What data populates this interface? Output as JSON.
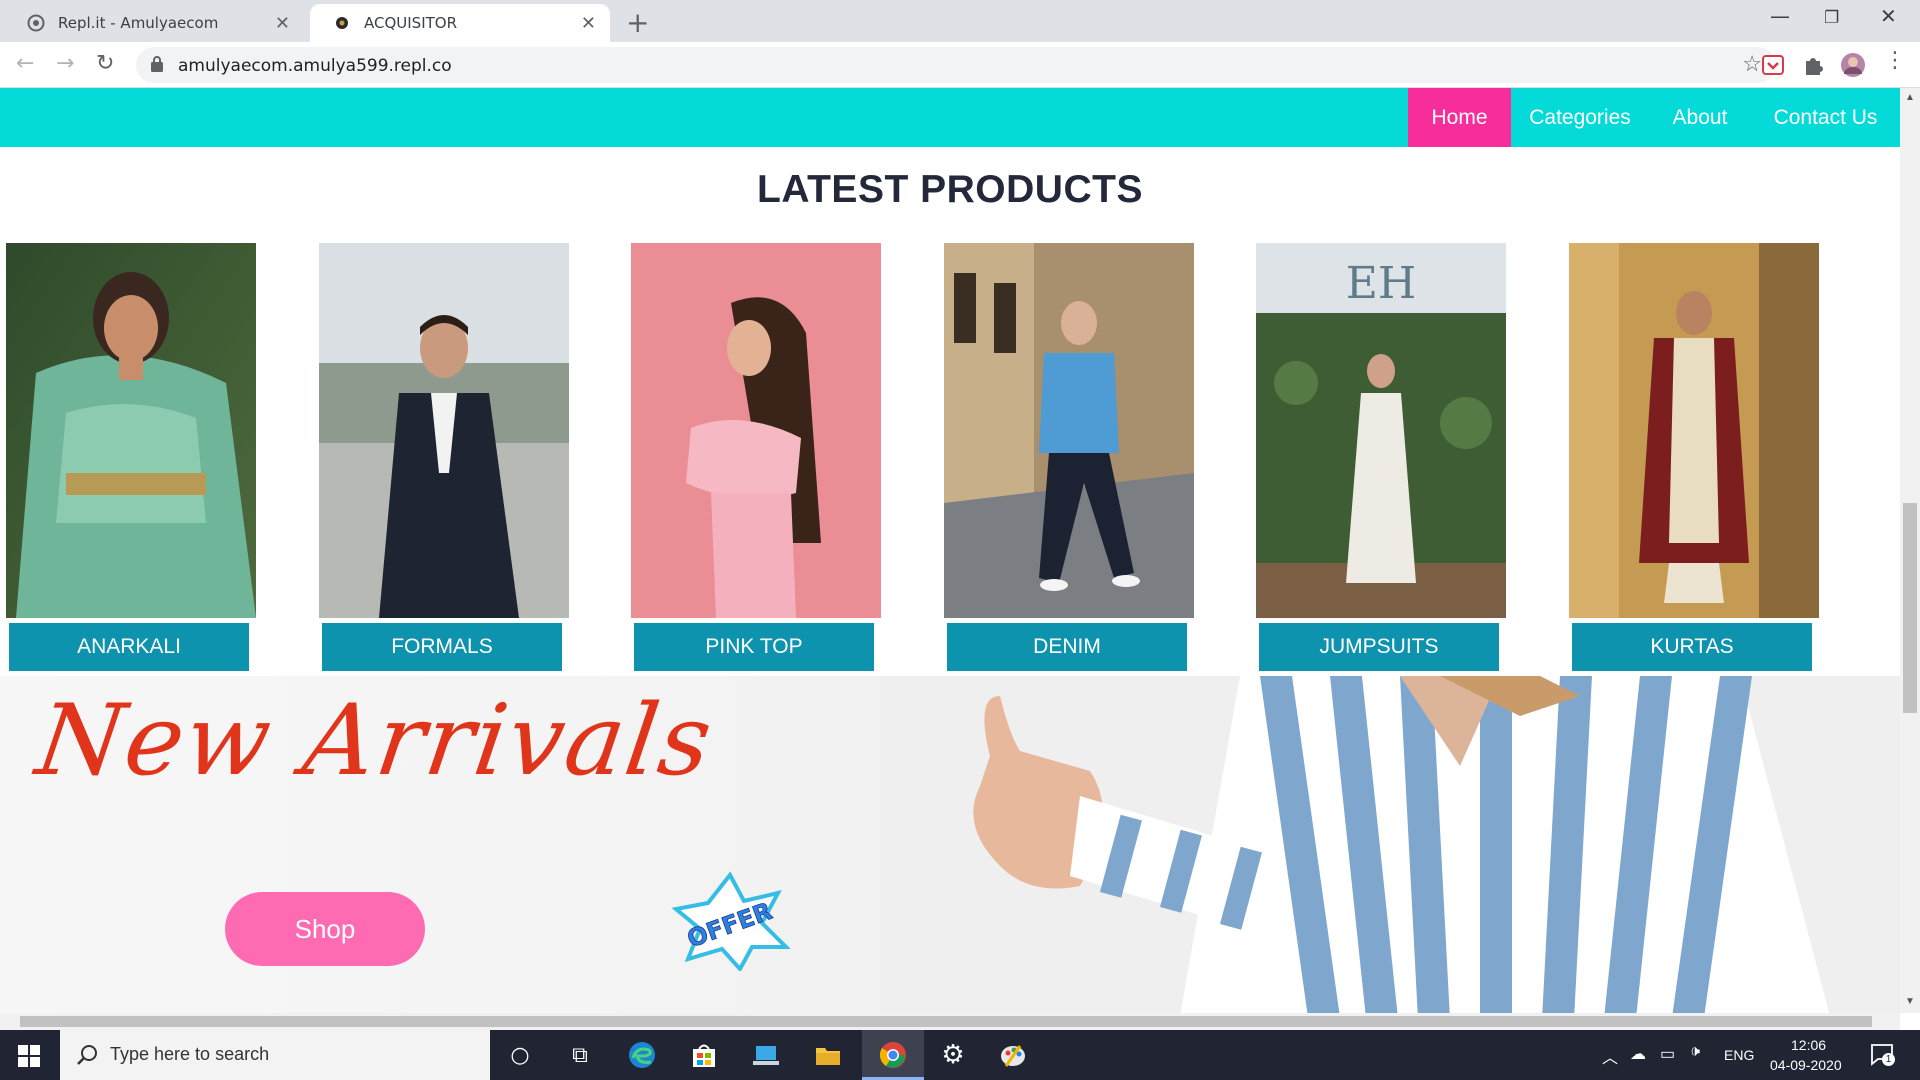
{
  "browser": {
    "tabs": [
      {
        "title": "Repl.it - Amulyaecom",
        "active": false
      },
      {
        "title": "ACQUISITOR",
        "active": true
      }
    ],
    "url": "amulyaecom.amulya599.repl.co"
  },
  "site": {
    "nav": [
      {
        "label": "Home",
        "active": true
      },
      {
        "label": "Categories",
        "active": false
      },
      {
        "label": "About",
        "active": false
      },
      {
        "label": "Contact Us",
        "active": false
      }
    ],
    "section_title": "LATEST PRODUCTS",
    "products": [
      {
        "label": "ANARKALI"
      },
      {
        "label": "FORMALS"
      },
      {
        "label": "PINK TOP"
      },
      {
        "label": "DENIM"
      },
      {
        "label": "JUMPSUITS"
      },
      {
        "label": "KURTAS"
      }
    ],
    "banner": {
      "heading": "New Arrivals",
      "button_label": "Shop",
      "badge_text": "OFFER"
    }
  },
  "taskbar": {
    "search_placeholder": "Type here to search",
    "language": "ENG",
    "time": "12:06",
    "date": "04-09-2020",
    "notification_count": "1"
  },
  "colors": {
    "nav_bg": "#04dbd9",
    "nav_active": "#f72d9b",
    "product_label": "#0e93ae",
    "shop_button": "#ff6bb3",
    "banner_heading": "#e0351b"
  }
}
